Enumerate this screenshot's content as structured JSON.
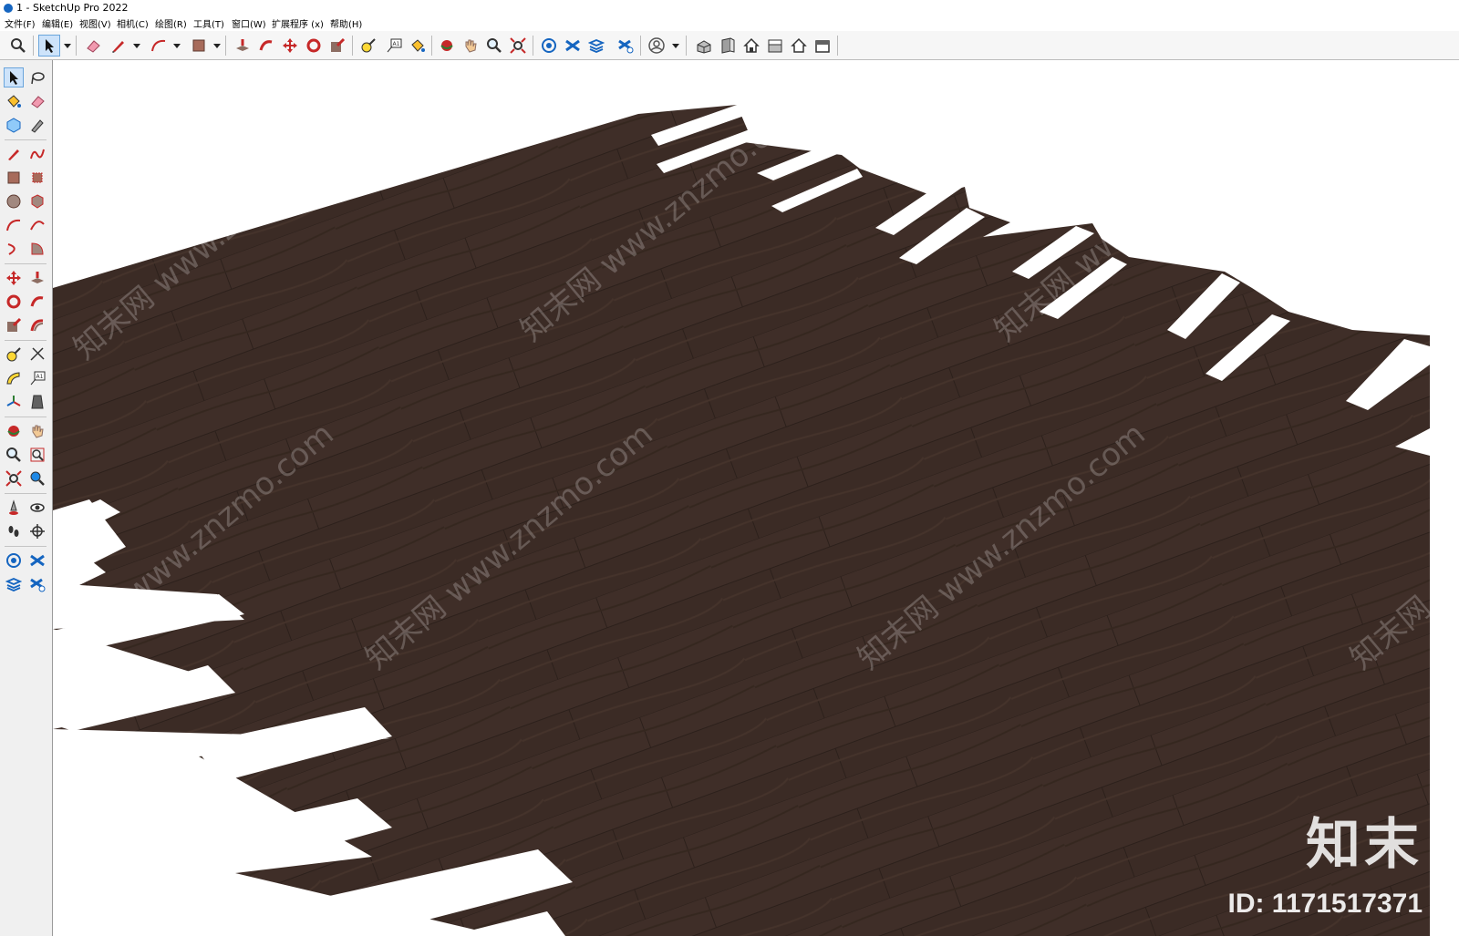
{
  "window": {
    "title": "1 - SketchUp Pro 2022"
  },
  "menu": {
    "items": [
      "文件(F)",
      "编辑(E)",
      "视图(V)",
      "相机(C)",
      "绘图(R)",
      "工具(T)",
      "窗口(W)",
      "扩展程序 (x)",
      "帮助(H)"
    ]
  },
  "toolbar": {
    "tools": [
      "zoom-icon",
      "select-icon",
      "eraser-icon",
      "pencil-icon",
      "arc-icon",
      "rectangle-icon",
      "push-pull-icon",
      "follow-me-icon",
      "move-icon",
      "rotate-icon",
      "scale-icon",
      "tape-measure-icon",
      "text-icon",
      "paint-bucket-icon",
      "orbit-icon",
      "pan-icon",
      "zoom-icon",
      "zoom-extents-icon",
      "model-info-icon",
      "tags-icon",
      "layers-icon",
      "outliner-icon",
      "account-icon",
      "iso-view-icon",
      "front-view-icon",
      "home-icon",
      "top-view-icon",
      "back-view-icon",
      "side-view-icon"
    ]
  },
  "watermark": {
    "text": "知末网 www.znzmo.com",
    "brand": "知末",
    "id_text": "ID: 1171517371"
  },
  "colors": {
    "wood": "#3b2b25",
    "wood_dark": "#2e221d",
    "wood_light": "#4a3730",
    "accent": "#cde3fa"
  }
}
